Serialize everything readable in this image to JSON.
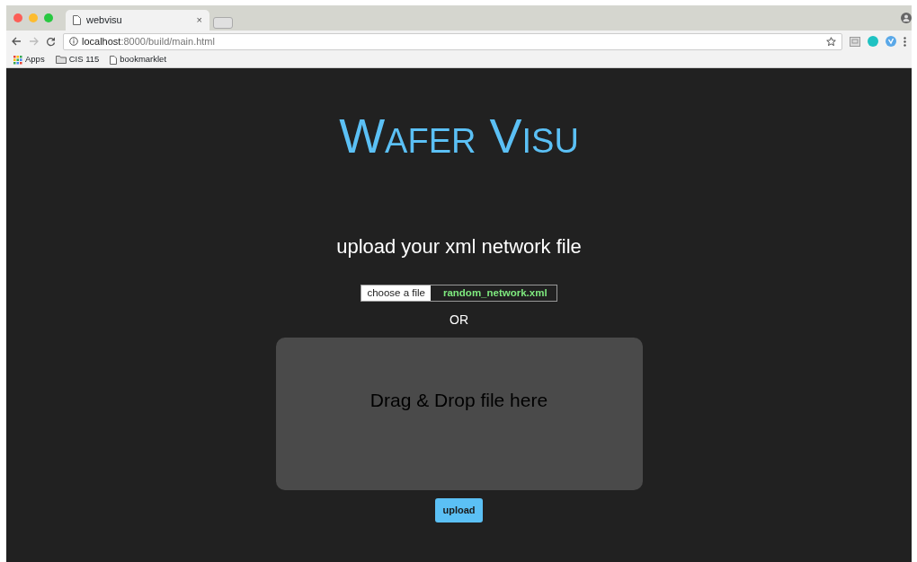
{
  "browser": {
    "tab_title": "webvisu",
    "tab_close": "×",
    "url_host": "localhost",
    "url_path": ":8000/build/main.html",
    "bookmarks": [
      {
        "kind": "apps",
        "label": "Apps"
      },
      {
        "kind": "folder",
        "label": "CIS 115"
      },
      {
        "kind": "page",
        "label": "bookmarklet"
      }
    ]
  },
  "page": {
    "title": "Wafer Visu",
    "heading": "upload your xml network file",
    "file_button": "choose a file",
    "file_name": "random_network.xml",
    "or_text": "OR",
    "drop_zone": "Drag & Drop file here",
    "upload_button": "upload"
  }
}
